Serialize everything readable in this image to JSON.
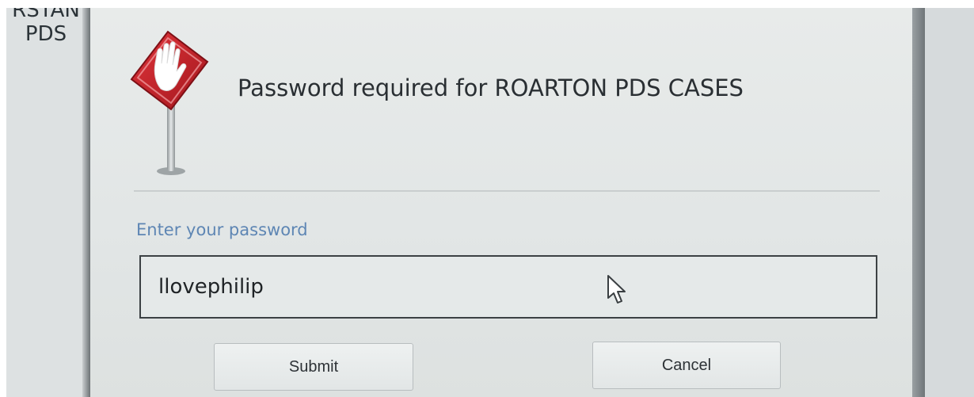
{
  "background_window": {
    "title_cut": "RSTAN",
    "title": "PDS"
  },
  "dialog": {
    "title": "Password required for ROARTON PDS CASES",
    "field_label": "Enter your password",
    "password_value": "llovephilip",
    "submit_label": "Submit",
    "cancel_label": "Cancel"
  },
  "icons": {
    "dialog_icon": "stop-hand-sign-icon",
    "pointer": "mouse-cursor-icon"
  },
  "colors": {
    "sign_red": "#c8232b",
    "label_blue": "#5e86b4"
  }
}
